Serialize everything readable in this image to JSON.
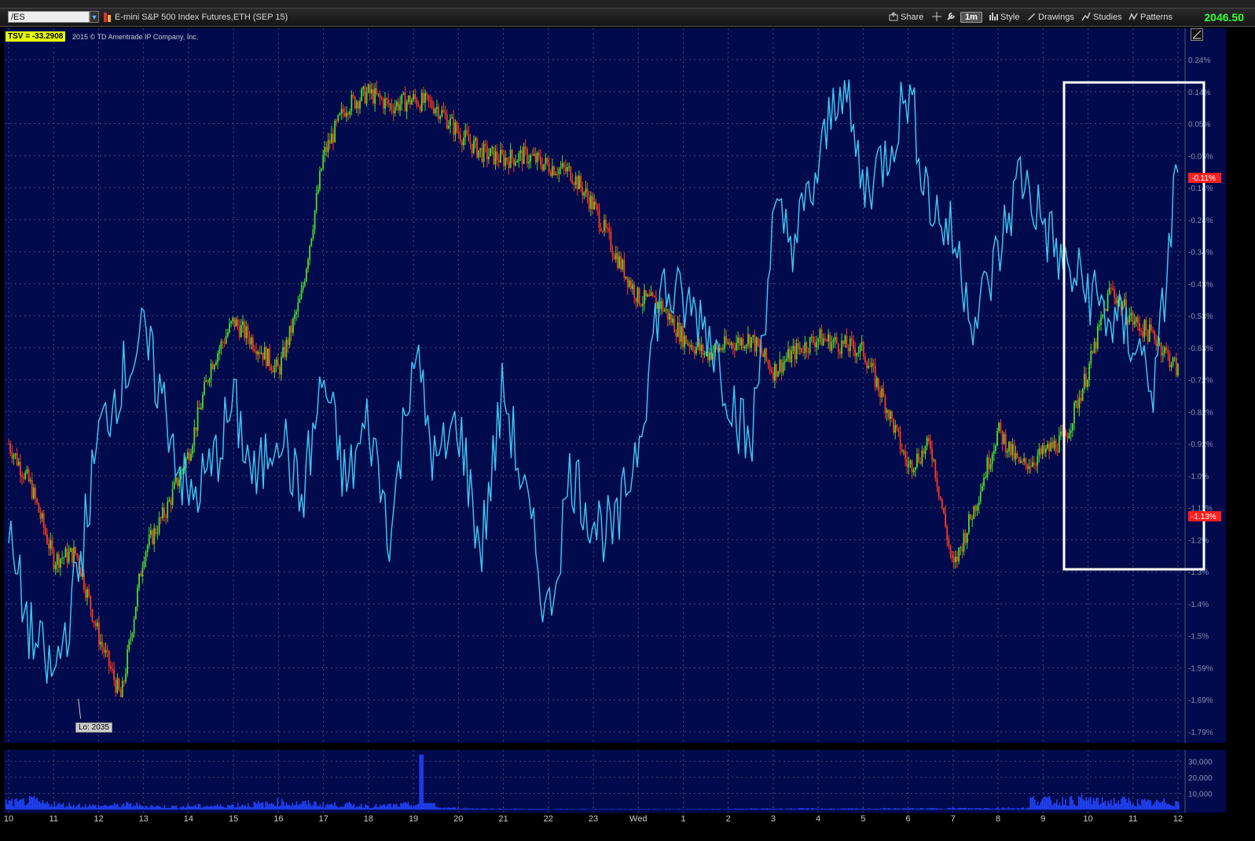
{
  "toolbar": {
    "symbol": "/ES",
    "description": "E-mini S&P 500 Index Futures,ETH (SEP 15)",
    "share_label": "Share",
    "interval_label": "1m",
    "style_label": "Style",
    "drawings_label": "Drawings",
    "studies_label": "Studies",
    "patterns_label": "Patterns",
    "last_price": "2046.50"
  },
  "study": {
    "label": "TSV  = -33.2908",
    "copyright": "2015 © TD Ameritrade IP Company, Inc."
  },
  "annotations": {
    "low_label": "Lo: 2035",
    "current_pct_upper": "-0.11%",
    "current_pct_lower": "-1.13%"
  },
  "colors": {
    "background": "#000a4c",
    "tsv_line": "#3ec3f0",
    "candle_up": "#4cdc2a",
    "candle_down": "#ff3a1a",
    "volume": "#2244ff",
    "grid": "#3b4f7a",
    "axis_text": "#7f8fb5",
    "highlight_box": "#ffffff",
    "pct_label_bg": "#ff2020"
  },
  "chart_data": [
    {
      "type": "line",
      "title": "E-mini S&P 500 Index Futures,ETH (SEP 15)",
      "x_ticks": [
        "10",
        "11",
        "12",
        "13",
        "14",
        "15",
        "16",
        "17",
        "18",
        "19",
        "20",
        "21",
        "22",
        "23",
        "Wed",
        "1",
        "2",
        "3",
        "4",
        "5",
        "6",
        "7",
        "8",
        "9",
        "10",
        "11",
        "12"
      ],
      "y_ticks": [
        "0.24%",
        "0.14%",
        "0.05%",
        "-0.05%",
        "-0.14%",
        "-0.24%",
        "-0.34%",
        "-0.43%",
        "-0.53%",
        "-0.63%",
        "-0.72%",
        "-0.82%",
        "-0.92%",
        "-1.0%",
        "-1.11%",
        "-1.2%",
        "-1.3%",
        "-1.4%",
        "-1.5%",
        "-1.59%",
        "-1.69%",
        "-1.79%"
      ],
      "ylim": [
        -1.79,
        0.24
      ],
      "grid": true,
      "series": [
        {
          "type": "candlestick",
          "x": [
            0,
            0.5,
            1,
            1.5,
            2,
            2.5,
            3,
            3.5,
            4,
            4.5,
            5,
            5.5,
            6,
            6.5,
            7,
            7.5,
            8,
            8.5,
            9,
            9.5,
            10,
            10.5,
            11,
            11.5,
            12,
            12.5,
            13,
            13.5,
            14,
            14.5,
            15,
            15.5,
            16,
            16.5,
            17,
            17.5,
            18,
            18.5,
            19,
            19.5,
            20,
            20.5,
            21,
            21.5,
            22,
            22.5,
            23,
            23.5,
            24,
            24.5,
            25,
            25.5,
            26
          ],
          "values": [
            -0.92,
            -1.05,
            -1.27,
            -1.25,
            -1.5,
            -1.69,
            -1.25,
            -1.12,
            -0.95,
            -0.68,
            -0.55,
            -0.62,
            -0.7,
            -0.48,
            -0.05,
            0.1,
            0.14,
            0.1,
            0.12,
            0.1,
            0.02,
            -0.04,
            -0.06,
            -0.05,
            -0.08,
            -0.1,
            -0.2,
            -0.35,
            -0.48,
            -0.5,
            -0.6,
            -0.65,
            -0.62,
            -0.6,
            -0.7,
            -0.64,
            -0.6,
            -0.62,
            -0.64,
            -0.8,
            -0.99,
            -0.92,
            -1.3,
            -1.1,
            -0.88,
            -0.99,
            -0.95,
            -0.9,
            -0.7,
            -0.45,
            -0.55,
            -0.6,
            -0.7
          ]
        },
        {
          "type": "line",
          "x": [
            0,
            0.5,
            1,
            1.5,
            2,
            2.5,
            3,
            3.5,
            4,
            4.5,
            5,
            5.5,
            6,
            6.5,
            7,
            7.5,
            8,
            8.5,
            9,
            9.5,
            10,
            10.5,
            11,
            11.5,
            12,
            12.5,
            13,
            13.5,
            14,
            14.5,
            15,
            15.5,
            16,
            16.5,
            17,
            17.5,
            18,
            18.5,
            19,
            19.5,
            20,
            20.5,
            21,
            21.5,
            22,
            22.5,
            23,
            23.5,
            24,
            24.5,
            25,
            25.5,
            26
          ],
          "values": [
            -1.22,
            -1.5,
            -1.63,
            -1.35,
            -0.9,
            -0.72,
            -0.6,
            -0.82,
            -1.1,
            -1.0,
            -0.8,
            -1.05,
            -0.85,
            -1.1,
            -0.72,
            -1.05,
            -0.85,
            -1.2,
            -0.62,
            -1.0,
            -0.85,
            -1.25,
            -0.75,
            -1.1,
            -1.45,
            -1.0,
            -1.15,
            -1.2,
            -0.9,
            -0.45,
            -0.5,
            -0.55,
            -0.75,
            -0.95,
            -0.25,
            -0.3,
            -0.1,
            0.2,
            -0.15,
            -0.05,
            0.15,
            -0.2,
            -0.3,
            -0.55,
            -0.35,
            -0.1,
            -0.25,
            -0.4,
            -0.45,
            -0.55,
            -0.6,
            -0.75,
            -0.05
          ]
        }
      ]
    },
    {
      "type": "bar",
      "title": "Volume",
      "y_ticks": [
        "30,000",
        "20,000",
        "10,000"
      ],
      "ylim": [
        0,
        36000
      ],
      "values": [
        6000,
        7000,
        5000,
        4000,
        3500,
        3000,
        3500,
        4000,
        3000,
        2500,
        2500,
        3000,
        3000,
        3500,
        4000,
        4500,
        6000,
        5000,
        5000,
        4000,
        4000,
        3500,
        3000,
        3500,
        4000,
        34000,
        1500,
        1200,
        900,
        700,
        600,
        500,
        500,
        400,
        400,
        400,
        400,
        400,
        500,
        400,
        400,
        400,
        500,
        500,
        600,
        700,
        800,
        800,
        800,
        800,
        700,
        700,
        800,
        900,
        900,
        900,
        1000,
        1100,
        1000,
        1200,
        1300,
        1200,
        8000,
        7000,
        7500,
        8000,
        6500,
        7000,
        6000,
        5500,
        6000,
        5000
      ]
    }
  ]
}
